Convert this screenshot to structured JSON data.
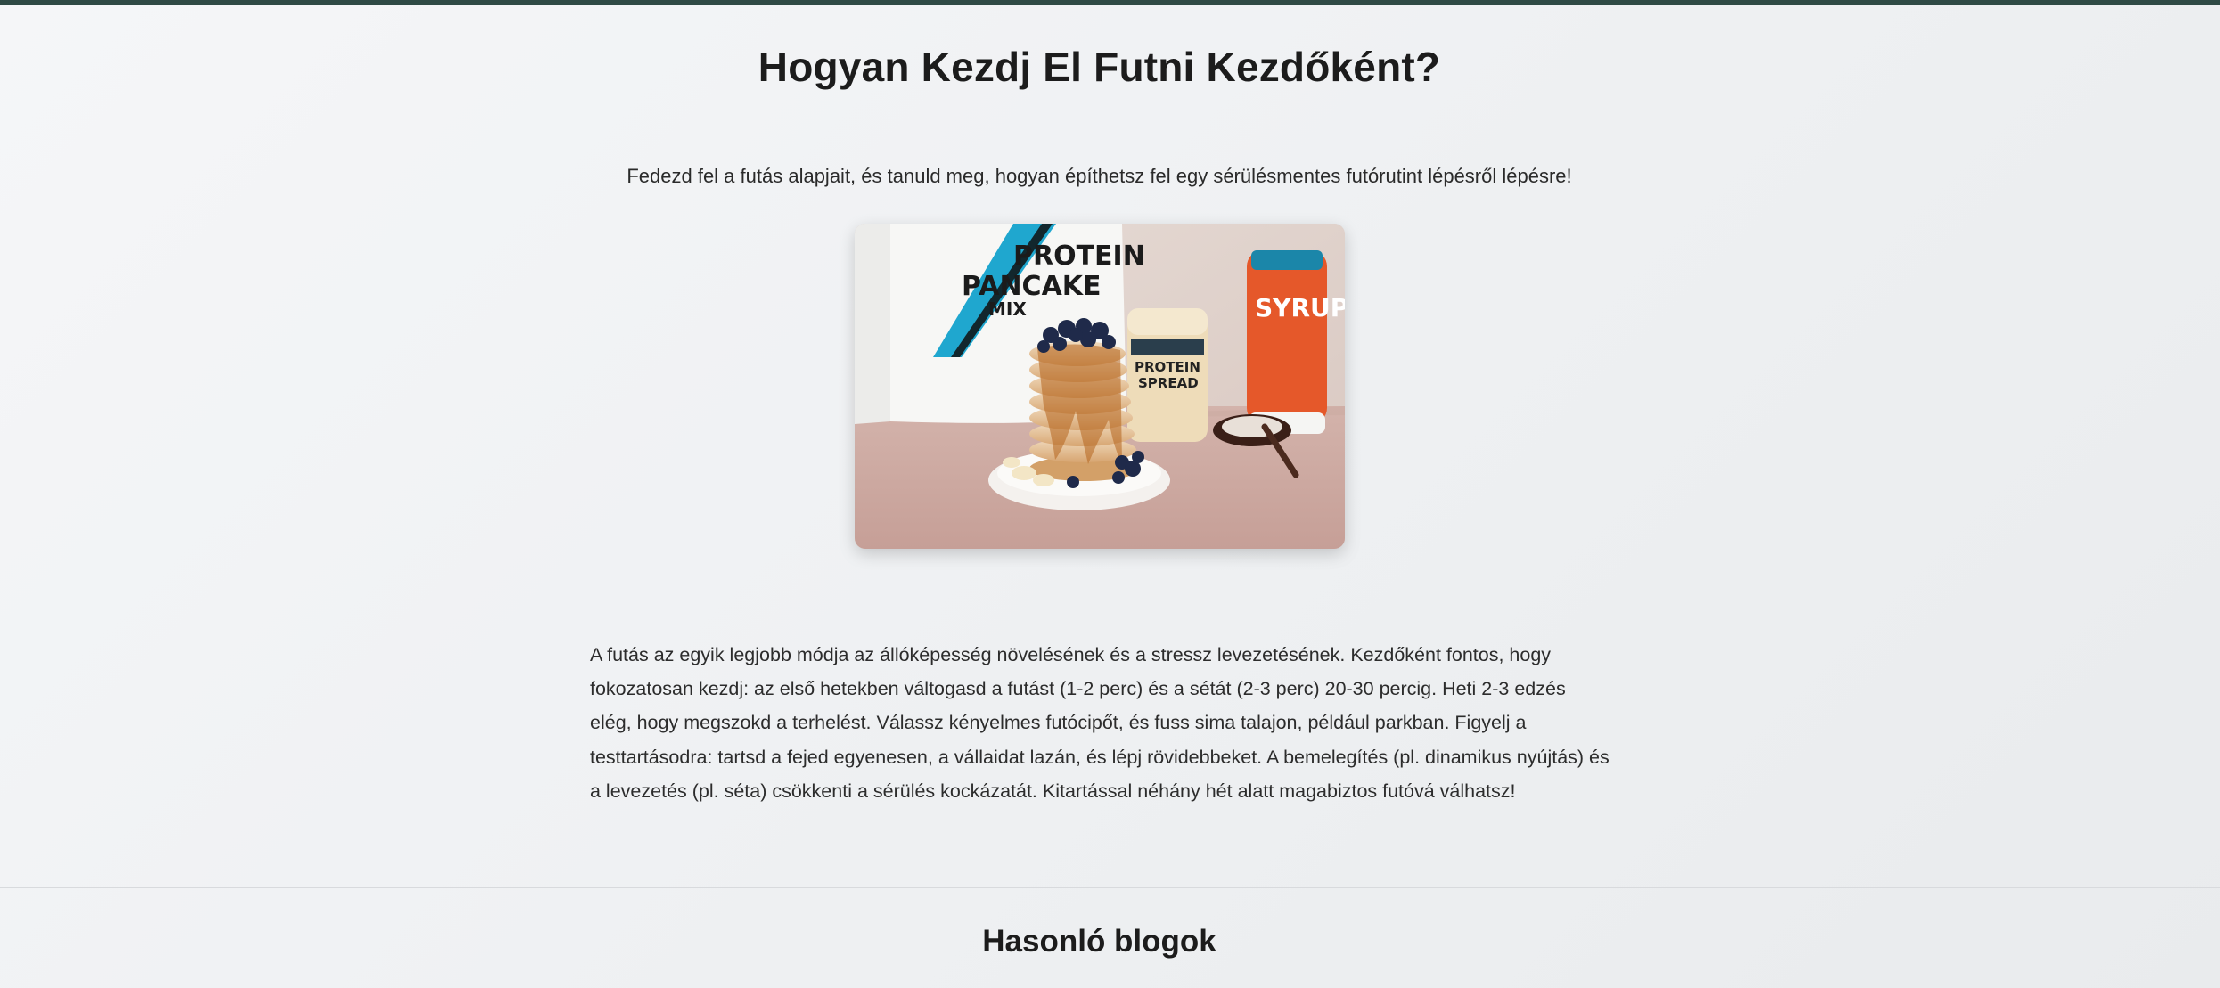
{
  "article": {
    "title": "Hogyan Kezdj El Futni Kezdőként?",
    "intro": "Fedezd fel a futás alapjait, és tanuld meg, hogyan építhetsz fel egy sérülésmentes futórutint lépésről lépésre!",
    "image": {
      "bag_text_line1": "PROTEIN",
      "bag_text_line2": "PANCAKE",
      "bag_text_line3": "MIX",
      "jar_text_line1": "PROTEIN",
      "jar_text_line2": "SPREAD",
      "bottle_text": "SYRUP"
    },
    "body": "A futás az egyik legjobb módja az állóképesség növelésének és a stressz levezetésének. Kezdőként fontos, hogy fokozatosan kezdj: az első hetekben váltogasd a futást (1-2 perc) és a sétát (2-3 perc) 20-30 percig. Heti 2-3 edzés elég, hogy megszokd a terhelést. Válassz kényelmes futócipőt, és fuss sima talajon, például parkban. Figyelj a testtartásodra: tartsd a fejed egyenesen, a vállaidat lazán, és lépj rövidebbeket. A bemelegítés (pl. dinamikus nyújtás) és a levezetés (pl. séta) csökkenti a sérülés kockázatát. Kitartással néhány hét alatt magabiztos futóvá válhatsz!"
  },
  "related": {
    "heading": "Hasonló blogok"
  },
  "colors": {
    "top_bar": "#2f4a45",
    "background": "#f0f2f4",
    "text": "#222222"
  }
}
